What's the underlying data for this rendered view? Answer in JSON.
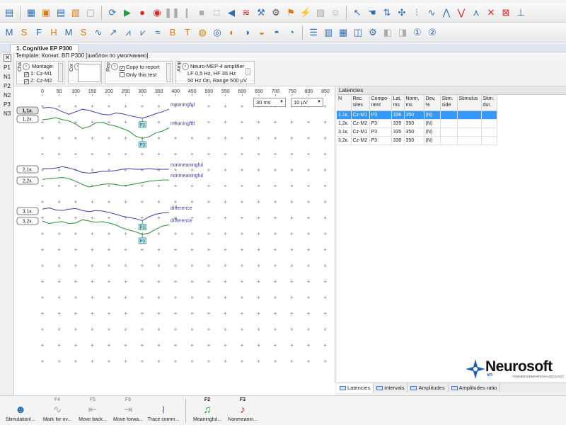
{
  "toolbar1_icons": [
    "template-icon",
    "open-icon",
    "box-icon",
    "save-icon",
    "print-icon",
    "disk-icon",
    "refresh-icon",
    "play-icon",
    "record-icon",
    "stimulus-icon",
    "pause-icon",
    "pause2-icon",
    "stop-icon",
    "square-icon",
    "speaker-icon",
    "curve1-icon",
    "hammer-icon",
    "filter-icon",
    "tools-icon",
    "flash-icon",
    "chart-icon",
    "person-icon",
    "cursor-icon",
    "pointer-icon",
    "arrows-icon",
    "cross-icon",
    "wave1-icon",
    "wave2-icon",
    "wave3-icon",
    "wave4-icon",
    "wave5-icon",
    "wave6-icon",
    "wave7-icon",
    "wave8-icon"
  ],
  "toolbar2_icons": [
    "marker-m-icon",
    "marker-s-icon",
    "marker-f-icon",
    "marker-h-icon",
    "marker-m2-icon",
    "marker-s2-icon",
    "wave-a-icon",
    "wave-b-icon",
    "wave-c-icon",
    "wave-d-icon",
    "wave-e-icon",
    "wave-br-icon",
    "wave-tf-icon",
    "wave-g-icon",
    "wave-h-icon",
    "wave-i-icon",
    "wave-j-icon",
    "wave-k-icon",
    "wave-l-icon",
    "wave-m-icon",
    "layout-icon",
    "bars-icon",
    "grid-icon",
    "split-icon",
    "settings-icon",
    "page-icon",
    "page2-icon",
    "number-icon",
    "number2-icon"
  ],
  "doc_tab": "1. Cognitive EP P300",
  "left_labels": [
    "P1",
    "N1",
    "P2",
    "N2",
    "P3",
    "N3"
  ],
  "template_text": "Template: Когнит. ВП P300 [шаблон по умолчанию]",
  "controls": {
    "cha_label": "Cha",
    "montage_label": "Montage:",
    "montage_items": [
      "1: Cz-M1",
      "2: Cz-M2"
    ],
    "cor_label": "Cor",
    "rep_label": "Rep",
    "copy_to_report": "Copy to report",
    "only_this_test": "Only this test",
    "amp_label": "Amp",
    "amp_name": "Neuro-MEP-4 amplifier",
    "amp_line1": "LF 0,5 Hz, HF 35 Hz",
    "amp_line2": "50 Hz On, Range 500 µV"
  },
  "chart_data": {
    "type": "line",
    "x_ticks": [
      "0",
      "50",
      "100",
      "150",
      "200",
      "250",
      "300",
      "350",
      "400",
      "450",
      "500",
      "550",
      "600",
      "650",
      "700",
      "750",
      "800",
      "850"
    ],
    "x_range": [
      0,
      850
    ],
    "time_per_div": "30 ms",
    "sensitivity": "10 µV",
    "series": [
      {
        "name": "1,1к.",
        "label": "meaningful",
        "color": "#3a3f9e",
        "row": 0,
        "x": [
          0,
          20,
          40,
          60,
          80,
          100,
          120,
          140,
          160,
          180,
          200,
          220,
          240,
          260,
          280,
          300,
          320,
          340,
          360,
          380
        ],
        "y": [
          4,
          5,
          3,
          -2,
          -6,
          -2,
          2,
          0,
          -3,
          -6,
          -7,
          -4,
          -5,
          -8,
          -10,
          -12,
          -9,
          -5,
          -2,
          2
        ]
      },
      {
        "name": "1,2к.",
        "label": "meaningful",
        "color": "#2c8a3a",
        "row": 0,
        "x": [
          0,
          20,
          40,
          60,
          80,
          100,
          120,
          140,
          160,
          180,
          200,
          220,
          240,
          260,
          280,
          300,
          320,
          340,
          360,
          380
        ],
        "y": [
          -1,
          0,
          2,
          -1,
          -3,
          -8,
          -15,
          -12,
          -6,
          -5,
          -9,
          -11,
          -15,
          -19,
          -27,
          -30,
          -28,
          -22,
          -19,
          -14
        ]
      },
      {
        "name": "2,1к.",
        "label": "nonmeaningful",
        "color": "#3a3f9e",
        "row": 1,
        "x": [
          0,
          20,
          40,
          60,
          80,
          100,
          120,
          140,
          160,
          180,
          200,
          220,
          240,
          260,
          280,
          300,
          320,
          340,
          360,
          380
        ],
        "y": [
          1,
          1,
          2,
          4,
          2,
          -1,
          -5,
          -6,
          -5,
          -3,
          -3,
          -2,
          0,
          1,
          0,
          0,
          1,
          0,
          0,
          0
        ]
      },
      {
        "name": "2,2к.",
        "label": "nonmeaningful",
        "color": "#2c8a3a",
        "row": 1,
        "x": [
          0,
          20,
          40,
          60,
          80,
          100,
          120,
          140,
          160,
          180,
          200,
          220,
          240,
          260,
          280,
          300,
          320,
          340,
          360,
          380
        ],
        "y": [
          2,
          3,
          4,
          5,
          3,
          -1,
          -6,
          -10,
          -8,
          -6,
          -5,
          -6,
          -8,
          -7,
          -5,
          -3,
          -1,
          0,
          1,
          1
        ]
      },
      {
        "name": "3,1к.",
        "label": "difference",
        "color": "#3a3f9e",
        "row": 2,
        "x": [
          0,
          20,
          40,
          60,
          80,
          100,
          120,
          140,
          160,
          180,
          200,
          220,
          240,
          260,
          280,
          300,
          320,
          340,
          360,
          380
        ],
        "y": [
          3,
          5,
          2,
          1,
          3,
          4,
          1,
          -1,
          1,
          0,
          -2,
          -5,
          -8,
          -10,
          -12,
          -15,
          -9,
          -5,
          -3,
          -2
        ]
      },
      {
        "name": "3,2к.",
        "label": "difference",
        "color": "#2c8a3a",
        "row": 2,
        "x": [
          0,
          20,
          40,
          60,
          80,
          100,
          120,
          140,
          160,
          180,
          200,
          220,
          240,
          260,
          280,
          300,
          320,
          340,
          360,
          380
        ],
        "y": [
          0,
          -4,
          -2,
          -1,
          -4,
          -3,
          2,
          0,
          -2,
          -1,
          -3,
          -6,
          -11,
          -14,
          -17,
          -21,
          -19,
          -13,
          -8,
          -6
        ]
      }
    ],
    "markers": [
      {
        "label": "P3",
        "series": 0,
        "x": 300
      },
      {
        "label": "P3",
        "series": 1,
        "x": 300
      },
      {
        "label": "P3",
        "series": 4,
        "x": 300
      },
      {
        "label": "P3",
        "series": 5,
        "x": 300
      }
    ]
  },
  "latencies": {
    "title": "Latencies",
    "headers": [
      "N",
      "Rec. sites",
      "Compo-nent",
      "Lat, ms",
      "Norm, ms",
      "Dev, %",
      "Stim. side",
      "Stimulus",
      "Stim. dur."
    ],
    "rows": [
      [
        "1,1к.",
        "Cz-M1",
        "P3",
        "336",
        "350",
        "(N)",
        "",
        "",
        ""
      ],
      [
        "1,2к.",
        "Cz-M2",
        "P3",
        "339",
        "350",
        "(N)",
        "",
        "",
        ""
      ],
      [
        "3,1к.",
        "Cz-M1",
        "P3",
        "335",
        "350",
        "(N)",
        "",
        "",
        ""
      ],
      [
        "3,2к.",
        "Cz-M2",
        "P3",
        "338",
        "350",
        "(N)",
        "",
        "",
        ""
      ]
    ]
  },
  "bottom_tabs": [
    "Latencies",
    "Intervals",
    "Amplitudes",
    "Amplitudes ratio"
  ],
  "fkeys": [
    {
      "key": "",
      "label": "Stimulation/...",
      "icon": "stimulation-icon"
    },
    {
      "key": "F4",
      "label": "Mark for ov...",
      "icon": "mark-icon"
    },
    {
      "key": "F5",
      "label": "Move back...",
      "icon": "move-back-icon"
    },
    {
      "key": "F6",
      "label": "Move forwa...",
      "icon": "move-forward-icon"
    },
    {
      "key": "",
      "label": "Trace comm...",
      "icon": "trace-icon"
    },
    {
      "key": "F2",
      "label": "Meaningful...",
      "icon": "meaningful-icon"
    },
    {
      "key": "F3",
      "label": "Nonmeanin...",
      "icon": "nonmeaningful-icon"
    }
  ],
  "logo": {
    "name": "Neurosoft",
    "vn": "vn",
    "tagline": "•TMS•EEG•EMG•PSG•AUDIOLOGY"
  }
}
